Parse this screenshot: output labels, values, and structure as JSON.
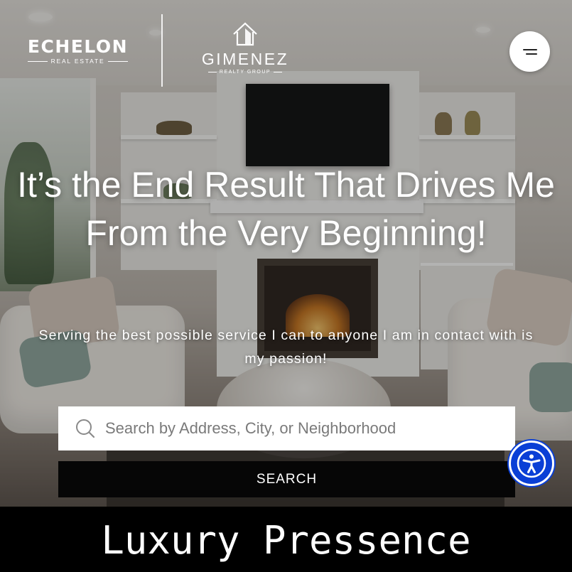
{
  "header": {
    "logo_primary": {
      "name": "ECHELON",
      "tagline": "REAL ESTATE"
    },
    "logo_secondary": {
      "name": "GIMENEZ",
      "tagline": "REALTY GROUP",
      "icon": "house-icon"
    },
    "menu_icon": "hamburger-menu-icon"
  },
  "hero": {
    "headline": "It’s the End Result That Drives Me From the Very Beginning!",
    "subheadline": "Serving the best possible service I can to anyone I am in contact with is my passion!"
  },
  "search": {
    "icon": "search-icon",
    "placeholder": "Search by Address, City, or Neighborhood",
    "button_label": "SEARCH"
  },
  "accessibility": {
    "icon": "accessibility-icon",
    "color": "#0a3fd6"
  },
  "banner": {
    "text": "Luxury Pressence"
  }
}
